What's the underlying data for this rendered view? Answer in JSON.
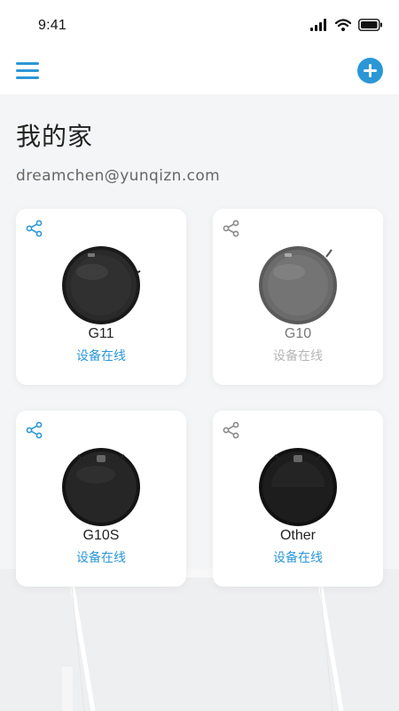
{
  "status_bar": {
    "time": "9:41"
  },
  "header": {
    "menu_icon": "hamburger-menu-icon",
    "add_icon": "plus-circle-icon",
    "accent_color": "#2b97d6"
  },
  "home": {
    "title": "我的家",
    "account_email": "dreamchen@yunqizn.com"
  },
  "devices": [
    {
      "name": "G11",
      "status": "设备在线",
      "online": true
    },
    {
      "name": "G10",
      "status": "设备在线",
      "online": false
    },
    {
      "name": "G10S",
      "status": "设备在线",
      "online": true
    },
    {
      "name": "Other",
      "status": "设备在线",
      "online": true
    }
  ]
}
